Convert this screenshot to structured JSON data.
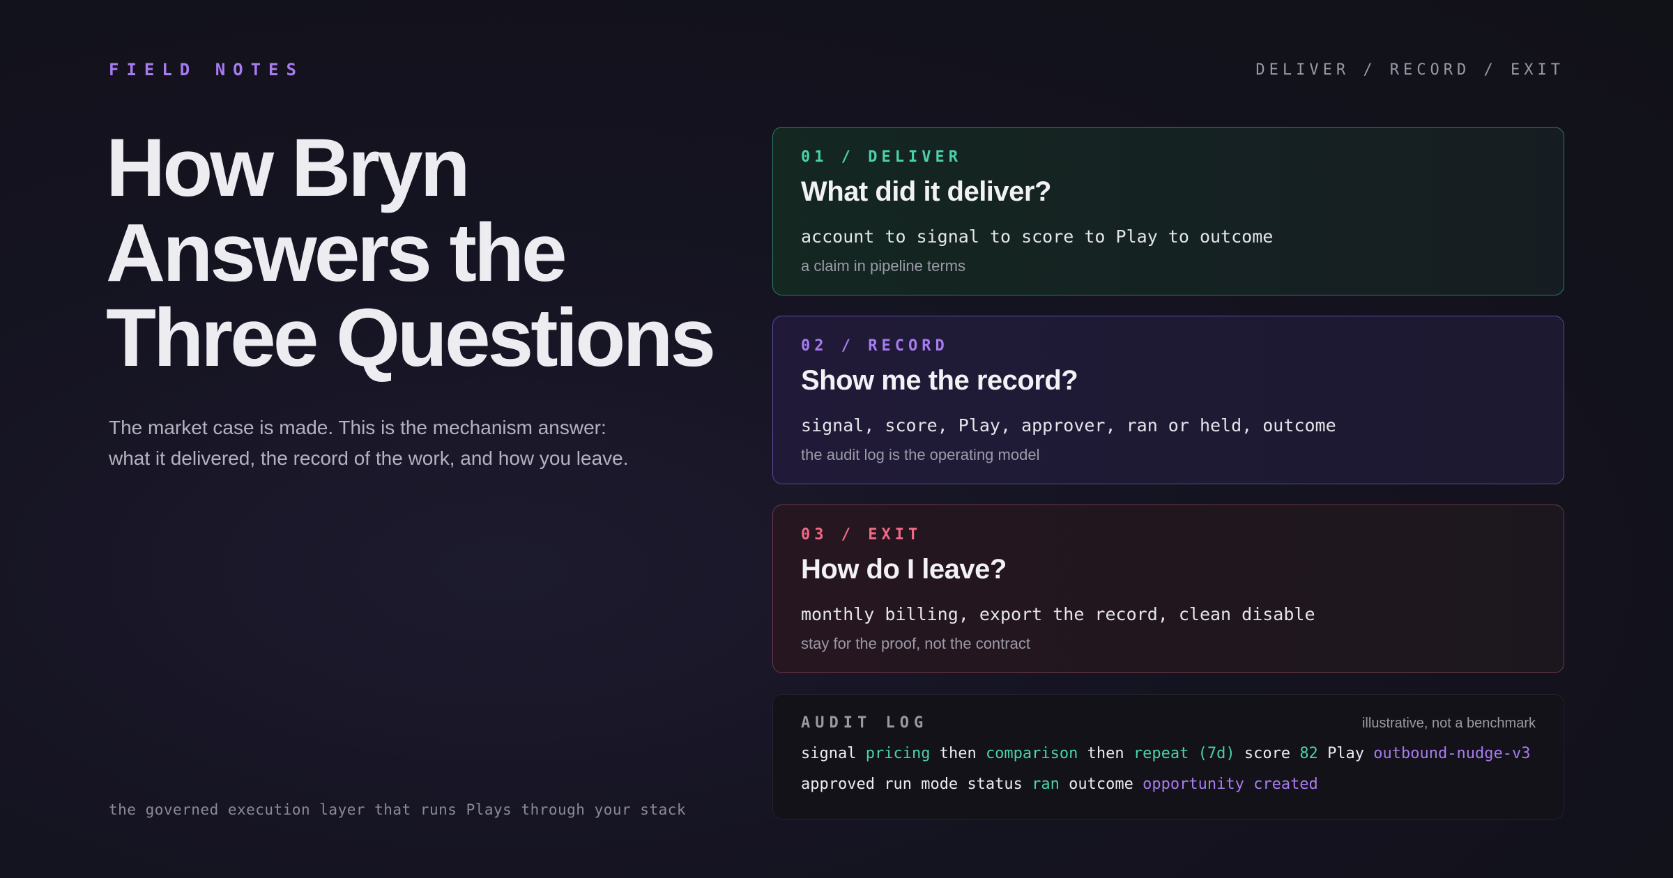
{
  "header": {
    "kicker": "FIELD NOTES",
    "nav": "DELIVER / RECORD / EXIT"
  },
  "hero": {
    "title_lines": [
      "How Bryn",
      "Answers the",
      "Three Questions"
    ],
    "intro_lines": [
      "The market case is made. This is the mechanism answer:",
      "what it delivered, the record of the work, and how you leave."
    ],
    "tagline": "the governed execution layer that runs Plays through your stack"
  },
  "cards": [
    {
      "num": "01 / DELIVER",
      "question": "What did it deliver?",
      "mono": "account to signal to score to Play to outcome",
      "sub": "a claim in pipeline terms",
      "accent": "#4bd1ac"
    },
    {
      "num": "02 / RECORD",
      "question": "Show me the record?",
      "mono": "signal, score, Play, approver, ran or held, outcome",
      "sub": "the audit log is the operating model",
      "accent": "#a77cf0"
    },
    {
      "num": "03 / EXIT",
      "question": "How do I leave?",
      "mono": "monthly billing, export the record, clean disable",
      "sub": "stay for the proof, not the contract",
      "accent": "#f26a86"
    }
  ],
  "audit": {
    "title": "AUDIT LOG",
    "note": "illustrative, not a benchmark",
    "line1": {
      "signal_label": "signal",
      "signal_value": "pricing",
      "then1": "then",
      "comparison": "comparison",
      "then2": "then",
      "repeat": "repeat (7d)",
      "score_label": "score",
      "score_value": "82",
      "play_label": "Play",
      "play_value": "outbound-nudge-v3"
    },
    "line2": {
      "approved": "approved",
      "run_mode": "run mode",
      "status_label": "status",
      "status_value": "ran",
      "outcome_label": "outcome",
      "outcome_value": "opportunity created"
    }
  }
}
